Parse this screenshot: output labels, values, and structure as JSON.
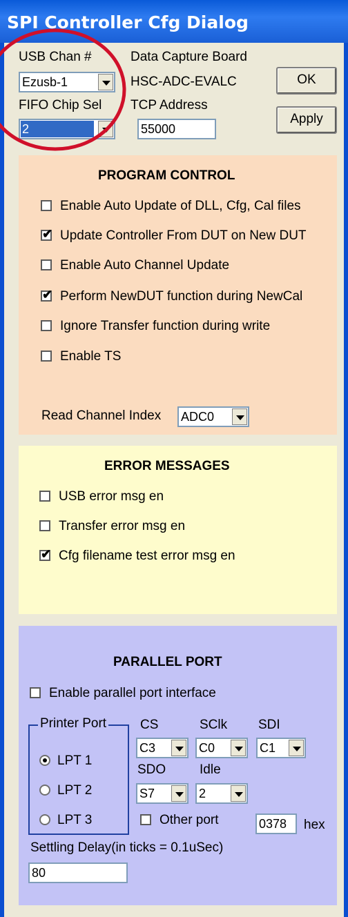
{
  "window": {
    "title": "SPI Controller Cfg Dialog"
  },
  "top": {
    "usb_chan_label": "USB Chan #",
    "usb_chan_value": "Ezusb-1",
    "fifo_label": "FIFO Chip Sel",
    "fifo_value": "2",
    "board_label": "Data Capture Board",
    "board_value": "HSC-ADC-EVALC",
    "tcp_label": "TCP Address",
    "tcp_value": "55000",
    "ok_label": "OK",
    "apply_label": "Apply"
  },
  "program_control": {
    "heading": "PROGRAM CONTROL",
    "items": [
      {
        "label": "Enable Auto Update of  DLL, Cfg, Cal files",
        "checked": false
      },
      {
        "label": "Update Controller From DUT on New DUT",
        "checked": true
      },
      {
        "label": "Enable Auto Channel Update",
        "checked": false
      },
      {
        "label": "Perform NewDUT function during NewCal",
        "checked": true
      },
      {
        "label": "Ignore Transfer function during write",
        "checked": false
      },
      {
        "label": "Enable TS",
        "checked": false
      }
    ],
    "read_channel_label": "Read Channel Index",
    "read_channel_value": "ADC0"
  },
  "error_messages": {
    "heading": "ERROR MESSAGES",
    "items": [
      {
        "label": "USB error msg en",
        "checked": false
      },
      {
        "label": "Transfer error msg en",
        "checked": false
      },
      {
        "label": "Cfg filename test error msg en",
        "checked": true
      }
    ]
  },
  "parallel_port": {
    "heading": "PARALLEL PORT",
    "enable_label": "Enable parallel port interface",
    "printer_port_label": "Printer Port",
    "ports": [
      {
        "label": "LPT 1",
        "selected": true
      },
      {
        "label": "LPT 2",
        "selected": false
      },
      {
        "label": "LPT 3",
        "selected": false
      }
    ],
    "cs_label": "CS",
    "cs_value": "C3",
    "sclk_label": "SClk",
    "sclk_value": "C0",
    "sdi_label": "SDI",
    "sdi_value": "C1",
    "sdo_label": "SDO",
    "sdo_value": "S7",
    "idle_label": "Idle",
    "idle_value": "2",
    "other_port_label": "Other port",
    "port_addr_value": "0378",
    "hex_label": "hex",
    "settling_label": "Settling Delay(in ticks = 0.1uSec)",
    "settling_value": "80"
  },
  "colors": {
    "program_bg": "#fbdcc0",
    "error_bg": "#fefccc",
    "parallel_bg": "#c3c3f6",
    "highlight_circle": "#d0102a"
  }
}
